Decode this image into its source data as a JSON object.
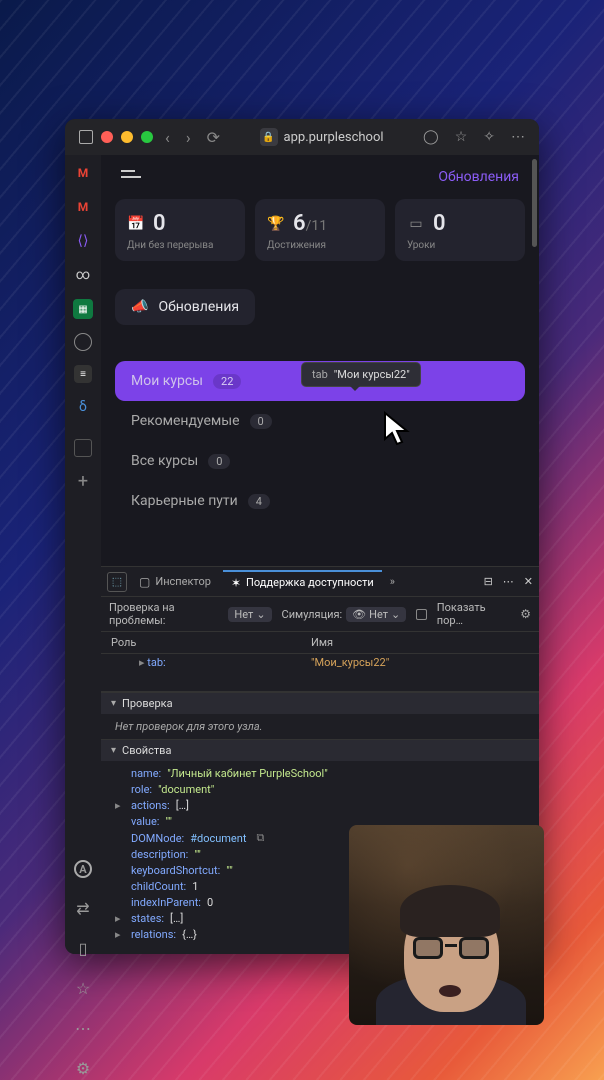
{
  "browser": {
    "url": "app.purpleschool",
    "tooltip_role": "tab",
    "tooltip_name": "\"Мои курсы22\""
  },
  "header": {
    "updates": "Обновления"
  },
  "stats": {
    "days": {
      "value": "0",
      "label": "Дни без перерыва"
    },
    "achieve": {
      "value": "6",
      "total": "/11",
      "label": "Достижения"
    },
    "lessons": {
      "value": "0",
      "label": "Уроки"
    }
  },
  "updates_btn": "Обновления",
  "tabs": [
    {
      "label": "Мои курсы",
      "count": "22"
    },
    {
      "label": "Рекомендуемые",
      "count": "0"
    },
    {
      "label": "Все курсы",
      "count": "0"
    },
    {
      "label": "Карьерные пути",
      "count": "4"
    }
  ],
  "devtools": {
    "inspector": "Инспектор",
    "a11y": "Поддержка доступности",
    "check_label": "Проверка на проблемы:",
    "check_val": "Нет",
    "sim_label": "Симуляция:",
    "sim_val": "Нет",
    "show_order": "Показать пор…",
    "col_role": "Роль",
    "col_name": "Имя",
    "row_role": "tab:",
    "row_name": "\"Мои_курсы22\"",
    "check_section": "Проверка",
    "check_empty": "Нет проверок для этого узла.",
    "props_section": "Свойства",
    "props": {
      "name_k": "name:",
      "name_v": "\"Личный кабинет PurpleSchool\"",
      "role_k": "role:",
      "role_v": "\"document\"",
      "actions_k": "actions:",
      "actions_v": "[…]",
      "value_k": "value:",
      "value_v": "\"\"",
      "dom_k": "DOMNode:",
      "dom_v": "#document",
      "desc_k": "description:",
      "desc_v": "\"\"",
      "kbd_k": "keyboardShortcut:",
      "kbd_v": "\"\"",
      "child_k": "childCount:",
      "child_v": "1",
      "idx_k": "indexInParent:",
      "idx_v": "0",
      "states_k": "states:",
      "states_v": "[…]",
      "rel_k": "relations:",
      "rel_v": "{…}"
    }
  }
}
